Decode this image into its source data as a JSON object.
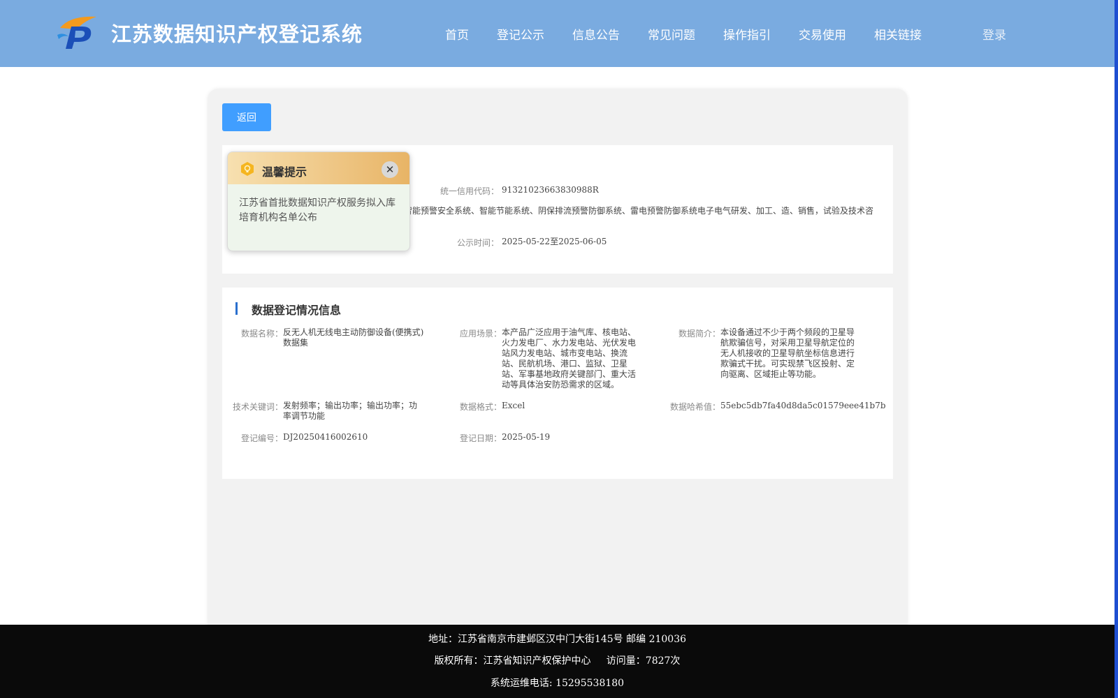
{
  "header": {
    "site_title": "江苏数据知识产权登记系统",
    "nav": [
      "首页",
      "登记公示",
      "信息公告",
      "常见问题",
      "操作指引",
      "交易使用",
      "相关链接"
    ],
    "login_label": "登录"
  },
  "main": {
    "back_label": "返回",
    "top_panel": {
      "credit_code_label": "统一信用代码：",
      "credit_code_value": "91321023663830988R",
      "business_scope_visible": "智能预警安全系统、智能节能系统、阴保排流预警防御系统、雷电预警防御系统电子电气研发、加工、造、销售，试验及技术咨",
      "publish_time_label": "公示时间：",
      "publish_time_value": "2025-05-22至2025-06-05"
    },
    "section": {
      "title": "数据登记情况信息",
      "fields": [
        {
          "label": "数据名称：",
          "value": "反无人机无线电主动防御设备(便携式)数据集"
        },
        {
          "label": "应用场景：",
          "value": "本产品广泛应用于油气库、核电站、火力发电厂、水力发电站、光伏发电站风力发电站、城市变电站、换流站、民航机场、港口、监狱、卫星站、军事基地政府关键部门、重大活动等具体治安防恐需求的区域。"
        },
        {
          "label": "数据简介：",
          "value": "本设备通过不少于两个频段的卫星导航欺骗信号，对采用卫星导航定位的无人机接收的卫星导航坐标信息进行欺骗式干扰。可实现禁飞区投射、定向驱离、区域拒止等功能。"
        },
        {
          "label": "技术关键词：",
          "value": "发射频率；输出功率；输出功率；功率调节功能"
        },
        {
          "label": "数据格式：",
          "value": "Excel"
        },
        {
          "label": "数据哈希值：",
          "value": "55ebc5db7fa40d8da5c01579eee41b7b"
        },
        {
          "label": "登记编号：",
          "value": "DJ20250416002610"
        },
        {
          "label": "登记日期：",
          "value": "2025-05-19"
        }
      ]
    }
  },
  "popup": {
    "title": "温馨提示",
    "close_symbol": "✕",
    "message": "江苏省首批数据知识产权服务拟入库培育机构名单公布"
  },
  "footer": {
    "address": "地址：江苏省南京市建邺区汉中门大街145号 邮编 210036",
    "copyright": "版权所有：江苏省知识产权保护中心     访问量：7827次",
    "hotline": "系统运维电话: 15295538180"
  },
  "colors": {
    "header_bg": "#7aabe0",
    "button_blue": "#409eff",
    "footer_bg": "#0a0a0a",
    "accent_strip": "#1f4fd1"
  }
}
